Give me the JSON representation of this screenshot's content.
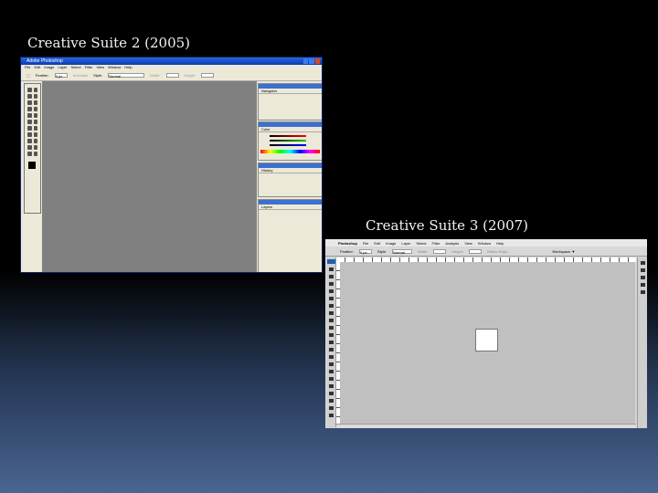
{
  "slide": {
    "title_cs2": "Creative Suite 2 (2005)",
    "title_cs3": "Creative Suite 3 (2007)"
  },
  "cs2": {
    "window_title": "Adobe Photoshop",
    "menu": [
      "File",
      "Edit",
      "Image",
      "Layer",
      "Select",
      "Filter",
      "View",
      "Window",
      "Help"
    ],
    "options": {
      "feather": "Feather:",
      "feather_value": "0 px",
      "antialias": "Anti-alias",
      "style": "Style:",
      "style_value": "Normal",
      "width": "Width:",
      "height": "Height:"
    },
    "panels": [
      "Navigator",
      "Color",
      "History",
      "Layers"
    ]
  },
  "cs3": {
    "app_name": "Photoshop",
    "menu": [
      "File",
      "Edit",
      "Image",
      "Layer",
      "Select",
      "Filter",
      "Analysis",
      "View",
      "Window",
      "Help"
    ],
    "options": {
      "feather": "Feather:",
      "feather_value": "0 px",
      "style": "Style:",
      "style_value": "Normal",
      "width": "Width:",
      "height": "Height:",
      "refine": "Refine Edge...",
      "workspace": "Workspace ▼"
    }
  }
}
